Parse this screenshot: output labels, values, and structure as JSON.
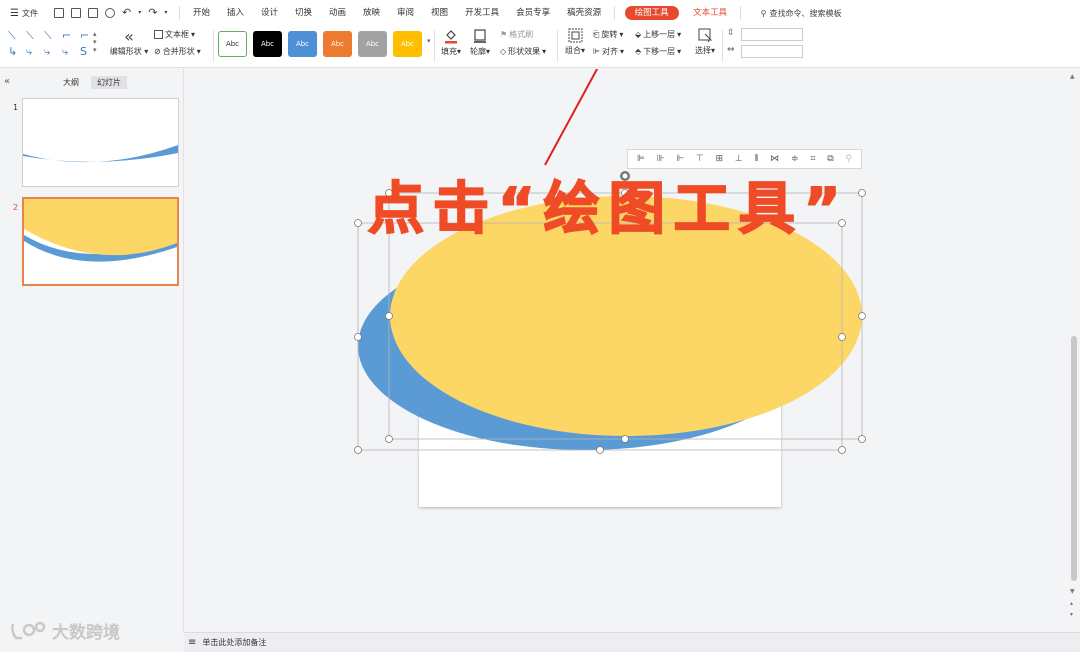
{
  "menubar": {
    "file_label": "文件",
    "tabs": [
      "开始",
      "插入",
      "设计",
      "切换",
      "动画",
      "放映",
      "审阅",
      "视图",
      "开发工具",
      "会员专享",
      "稿壳资源"
    ],
    "drawing_tool_tab": "绘图工具",
    "text_tool_tab": "文本工具",
    "search_label": "查找命令、搜索模板"
  },
  "ribbon": {
    "edit_shape": "编辑形状",
    "text_box": "文本框",
    "merge_shape": "合并形状",
    "styles": [
      {
        "label": "Abc",
        "bg": "#ffffff",
        "fg": "#333333",
        "border": "#5fae5a"
      },
      {
        "label": "Abc",
        "bg": "#000000",
        "fg": "#ffffff",
        "border": "#000000"
      },
      {
        "label": "Abc",
        "bg": "#4e90d6",
        "fg": "#ffffff",
        "border": "#4e90d6"
      },
      {
        "label": "Abc",
        "bg": "#ec7a31",
        "fg": "#ffffff",
        "border": "#ec7a31"
      },
      {
        "label": "Abc",
        "bg": "#a2a2a2",
        "fg": "#ffffff",
        "border": "#a2a2a2"
      },
      {
        "label": "Abc",
        "bg": "#fdbf00",
        "fg": "#ffffff",
        "border": "#fdbf00"
      }
    ],
    "fill": "填充",
    "outline": "轮廓",
    "format_painter": "格式刷",
    "shape_effect": "形状效果",
    "group": "组合",
    "rotate": "旋转",
    "align": "对齐",
    "bring_forward": "上移一层",
    "send_backward": "下移一层",
    "select": "选择"
  },
  "leftpanel": {
    "tab_outline": "大纲",
    "tab_slides": "幻灯片",
    "slides": [
      "1",
      "2"
    ]
  },
  "annotation": "点击“绘图工具”",
  "statusbar": {
    "notes_placeholder": "单击此处添加备注"
  },
  "watermark": "大数跨境",
  "colors": {
    "accent": "#e6492d",
    "ellipse_yellow": "#fdd766",
    "ellipse_blue": "#5b9bd5",
    "handle": "#777777"
  }
}
